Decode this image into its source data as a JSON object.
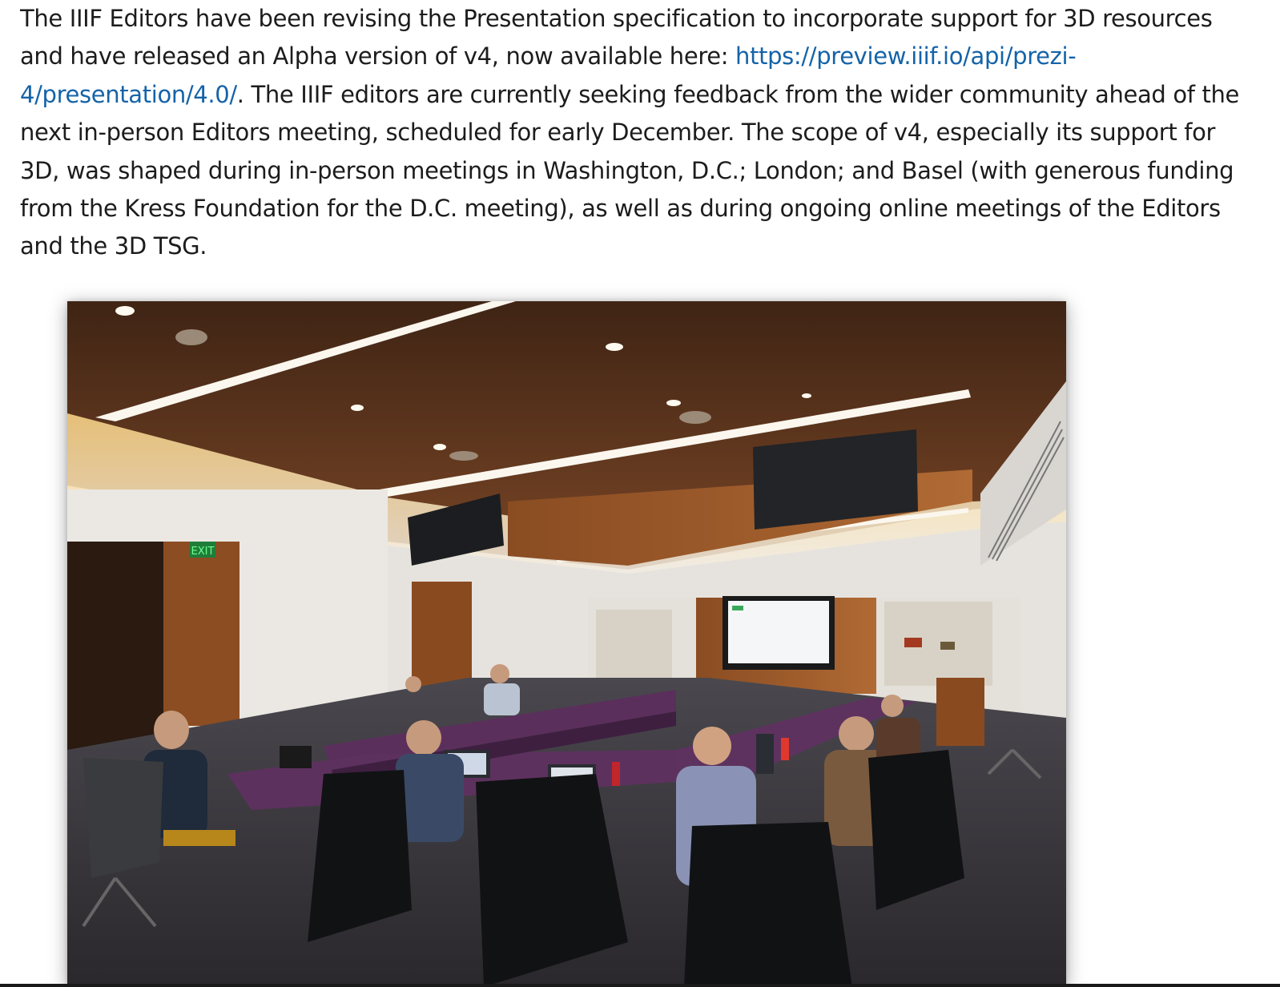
{
  "article": {
    "text_before_link": "The IIIF Editors have been revising the Presentation specification to incorporate support for 3D resources and have released an Alpha version of v4, now available here: ",
    "link_text": "https://preview.iiif.io/api/prezi-4/presentation/4.0/",
    "text_after_link": ". The IIIF editors are currently seeking feedback from the wider community ahead of the next in-person Editors meeting, scheduled for early December. The scope of v4, especially its support for 3D, was shaped during in-person meetings in Washington, D.C.; London; and Basel (with generous funding from the Kress Foundation for the D.C. meeting), as well as during ongoing online meetings of the Editors and the 3D TSG."
  },
  "photo": {
    "exit_sign": "EXIT",
    "colors": {
      "ceiling_wood": "#5a3520",
      "wall_wood": "#9a5a2c",
      "table_purple": "#5b2f5c",
      "carpet": "#3c3a3f",
      "wall_white": "#e8e6e2",
      "exit_green": "#2bd35a"
    }
  },
  "colors": {
    "link": "#1463a8",
    "text": "#1c1c1c"
  }
}
